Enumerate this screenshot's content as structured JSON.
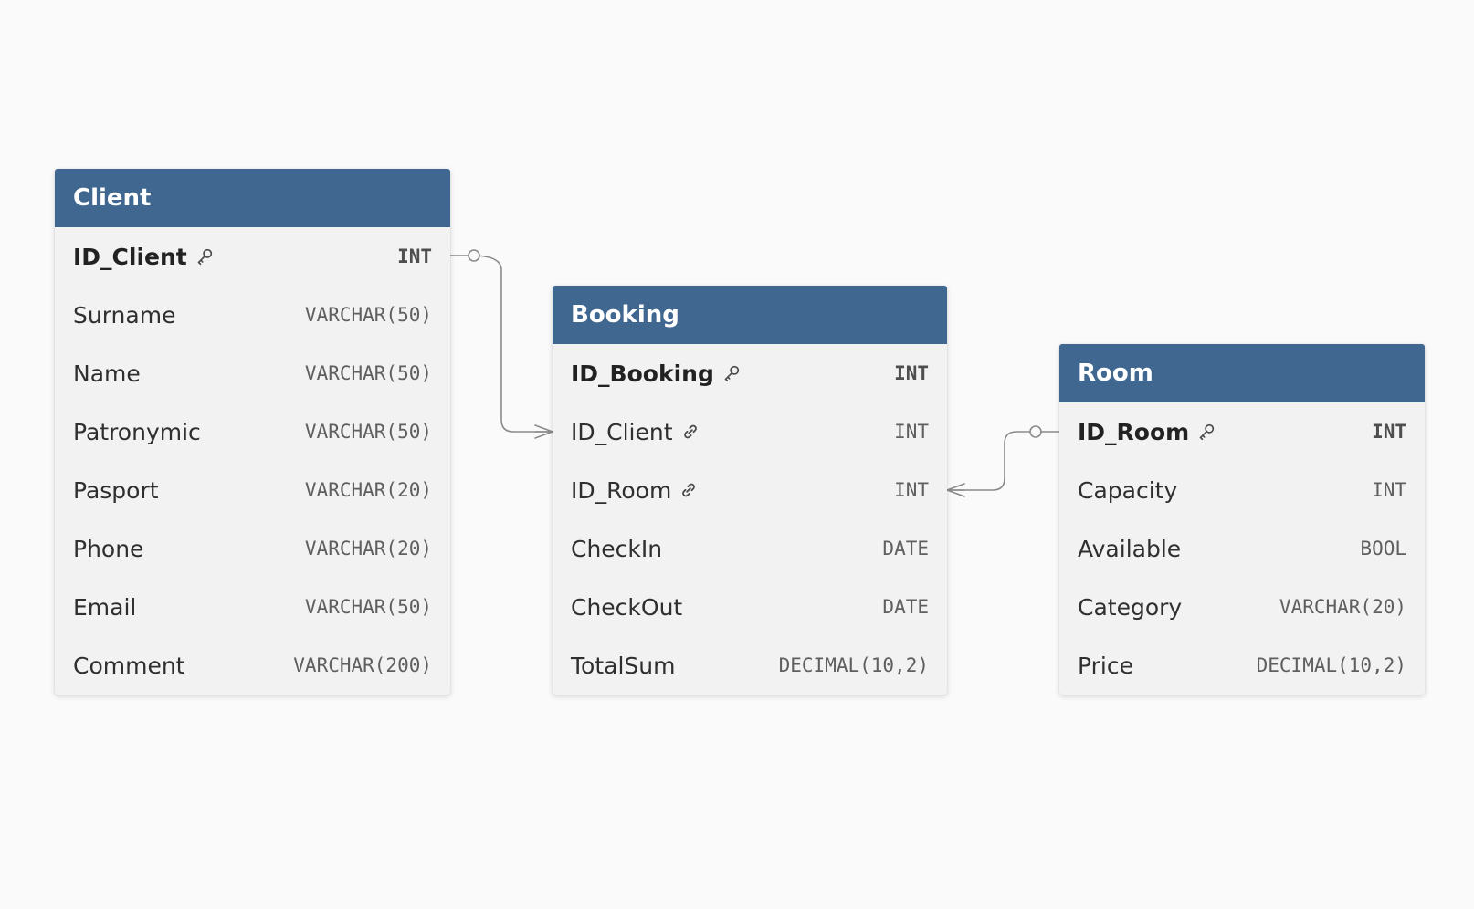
{
  "entities": {
    "client": {
      "title": "Client",
      "fields": [
        {
          "name": "ID_Client",
          "type": "INT",
          "key": "primary-key",
          "icon": "key-icon"
        },
        {
          "name": "Surname",
          "type": "VARCHAR(50)",
          "key": "",
          "icon": ""
        },
        {
          "name": "Name",
          "type": "VARCHAR(50)",
          "key": "",
          "icon": ""
        },
        {
          "name": "Patronymic",
          "type": "VARCHAR(50)",
          "key": "",
          "icon": ""
        },
        {
          "name": "Pasport",
          "type": "VARCHAR(20)",
          "key": "",
          "icon": ""
        },
        {
          "name": "Phone",
          "type": "VARCHAR(20)",
          "key": "",
          "icon": ""
        },
        {
          "name": "Email",
          "type": "VARCHAR(50)",
          "key": "",
          "icon": ""
        },
        {
          "name": "Comment",
          "type": "VARCHAR(200)",
          "key": "",
          "icon": ""
        }
      ]
    },
    "booking": {
      "title": "Booking",
      "fields": [
        {
          "name": "ID_Booking",
          "type": "INT",
          "key": "primary-key",
          "icon": "key-icon"
        },
        {
          "name": "ID_Client",
          "type": "INT",
          "key": "foreign-key",
          "icon": "link-icon"
        },
        {
          "name": "ID_Room",
          "type": "INT",
          "key": "foreign-key",
          "icon": "link-icon"
        },
        {
          "name": "CheckIn",
          "type": "DATE",
          "key": "",
          "icon": ""
        },
        {
          "name": "CheckOut",
          "type": "DATE",
          "key": "",
          "icon": ""
        },
        {
          "name": "TotalSum",
          "type": "DECIMAL(10,2)",
          "key": "",
          "icon": ""
        }
      ]
    },
    "room": {
      "title": "Room",
      "fields": [
        {
          "name": "ID_Room",
          "type": "INT",
          "key": "primary-key",
          "icon": "key-icon"
        },
        {
          "name": "Capacity",
          "type": "INT",
          "key": "",
          "icon": ""
        },
        {
          "name": "Available",
          "type": "BOOL",
          "key": "",
          "icon": ""
        },
        {
          "name": "Category",
          "type": "VARCHAR(20)",
          "key": "",
          "icon": ""
        },
        {
          "name": "Price",
          "type": "DECIMAL(10,2)",
          "key": "",
          "icon": ""
        }
      ]
    }
  },
  "relationships": [
    {
      "from_entity": "Client",
      "from_field": "ID_Client",
      "to_entity": "Booking",
      "to_field": "ID_Client",
      "from_cardinality": "zero-or-one",
      "to_cardinality": "many"
    },
    {
      "from_entity": "Room",
      "from_field": "ID_Room",
      "to_entity": "Booking",
      "to_field": "ID_Room",
      "from_cardinality": "zero-or-one",
      "to_cardinality": "many"
    }
  ],
  "colors": {
    "header": "#406790",
    "body": "#f2f2f2",
    "background": "#fafafa",
    "connector": "#8a8a8a",
    "text": "#2f2f2f",
    "type": "#5f5f5f"
  }
}
